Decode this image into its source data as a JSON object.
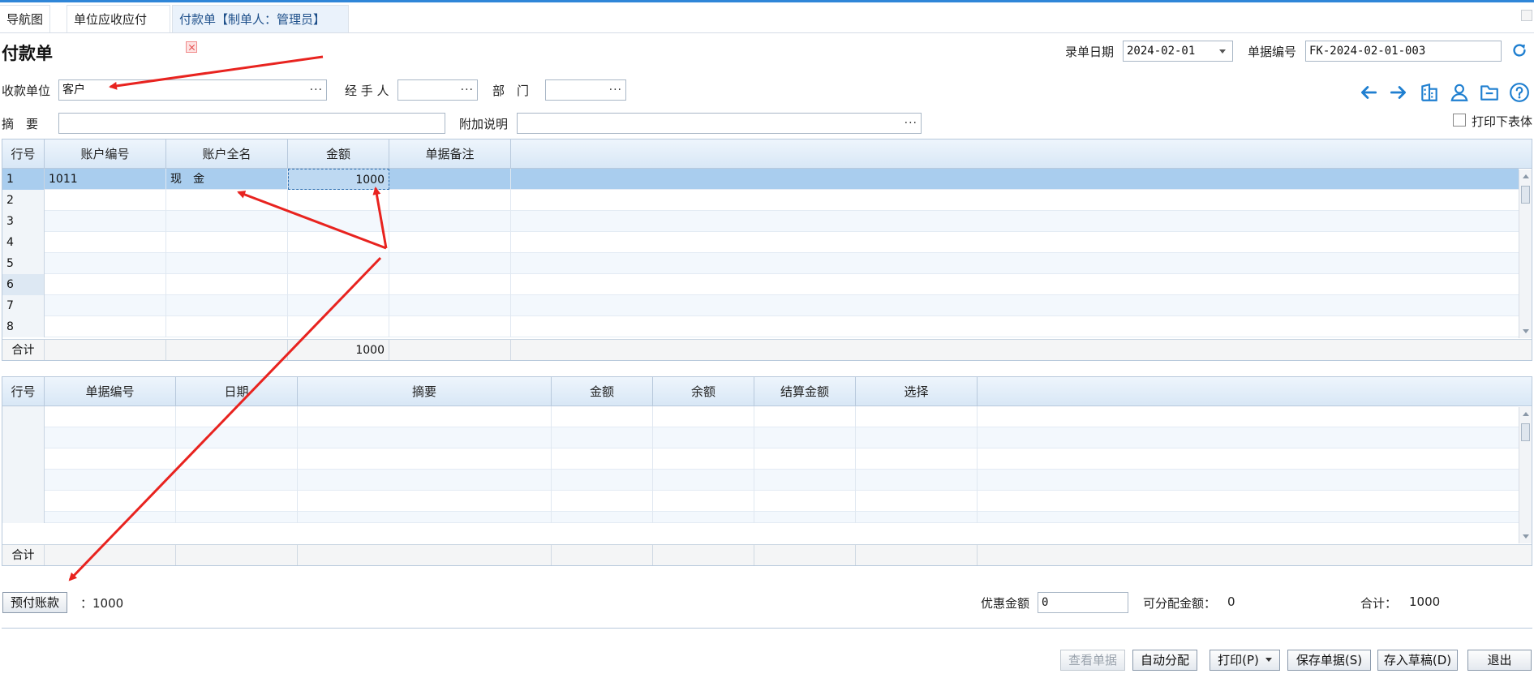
{
  "tabs": [
    {
      "label": "导航图"
    },
    {
      "label": "单位应收应付"
    },
    {
      "label": "付款单【制单人：管理员】"
    }
  ],
  "page": {
    "title": "付款单"
  },
  "header": {
    "date_label": "录单日期",
    "date_value": "2024-02-01",
    "docno_label": "单据编号",
    "docno_value": "FK-2024-02-01-003"
  },
  "form": {
    "payee_label": "收款单位",
    "payee_value": "客户",
    "handler_label": "经 手 人",
    "handler_value": "",
    "dept_label": "部　门",
    "dept_value": "",
    "summary_label": "摘　要",
    "summary_value": "",
    "extra_label": "附加说明",
    "extra_value": "",
    "print_lower_label": "打印下表体",
    "ellipsis": "···"
  },
  "toolbar_icons": [
    "arrow-left-icon",
    "arrow-right-icon",
    "building-icon",
    "user-icon",
    "folder-icon",
    "help-icon"
  ],
  "grid1": {
    "columns": [
      "行号",
      "账户编号",
      "账户全名",
      "金额",
      "单据备注"
    ],
    "rows": [
      {
        "no": "1",
        "code": "1011",
        "name": "现　金",
        "amount": "1000",
        "note": ""
      },
      {
        "no": "2",
        "code": "",
        "name": "",
        "amount": "",
        "note": ""
      },
      {
        "no": "3",
        "code": "",
        "name": "",
        "amount": "",
        "note": ""
      },
      {
        "no": "4",
        "code": "",
        "name": "",
        "amount": "",
        "note": ""
      },
      {
        "no": "5",
        "code": "",
        "name": "",
        "amount": "",
        "note": ""
      },
      {
        "no": "6",
        "code": "",
        "name": "",
        "amount": "",
        "note": ""
      },
      {
        "no": "7",
        "code": "",
        "name": "",
        "amount": "",
        "note": ""
      },
      {
        "no": "8",
        "code": "",
        "name": "",
        "amount": "",
        "note": ""
      }
    ],
    "total_label": "合计",
    "total_amount": "1000"
  },
  "grid2": {
    "columns": [
      "行号",
      "单据编号",
      "日期",
      "摘要",
      "金额",
      "余额",
      "结算金额",
      "选择"
    ],
    "total_label": "合计"
  },
  "footer": {
    "prepaid_button": "预付账款",
    "prepaid_value": "：1000",
    "discount_label": "优惠金额",
    "discount_value": "0",
    "allocatable_label": "可分配金额：",
    "allocatable_value": "0",
    "total_label": "合计：",
    "total_value": "1000"
  },
  "buttons": {
    "view": "查看单据",
    "auto": "自动分配",
    "print": "打印(P)",
    "save": "保存单据(S)",
    "draft": "存入草稿(D)",
    "exit": "退出"
  },
  "colors": {
    "accent": "#2f86d8",
    "selected_row": "#a9cdee",
    "annotation": "#e8231f"
  }
}
